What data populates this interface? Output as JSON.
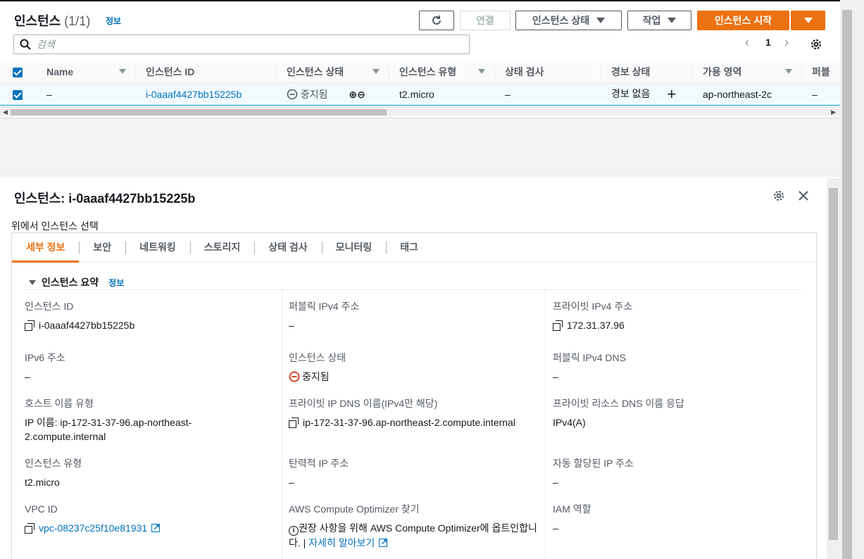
{
  "header": {
    "title": "인스턴스",
    "count": "(1/1)",
    "info": "정보",
    "buttons": {
      "connect": "연결",
      "instance_state": "인스턴스 상태",
      "actions": "작업",
      "launch": "인스턴스 시작"
    },
    "search_placeholder": "검색",
    "page": "1"
  },
  "table": {
    "columns": [
      "Name",
      "인스턴스 ID",
      "인스턴스 상태",
      "인스턴스 유형",
      "상태 검사",
      "경보 상태",
      "가용 영역",
      "퍼블"
    ],
    "row": {
      "name": "–",
      "instance_id": "i-0aaaf4427bb15225b",
      "state": "중지됨",
      "type": "t2.micro",
      "status_check": "–",
      "alarm": "경보 없음",
      "az": "ap-northeast-2c",
      "public": "–"
    }
  },
  "detail": {
    "title": "인스턴스: i-0aaaf4427bb15225b",
    "select_hint": "위에서 인스턴스 선택",
    "tabs": [
      "세부 정보",
      "보안",
      "네트워킹",
      "스토리지",
      "상태 검사",
      "모니터링",
      "태그"
    ],
    "summary_title": "인스턴스 요약",
    "summary_info": "정보",
    "fields": {
      "instance_id_label": "인스턴스 ID",
      "instance_id": "i-0aaaf4427bb15225b",
      "public_ipv4_label": "퍼블릭 IPv4 주소",
      "public_ipv4": "–",
      "private_ipv4_label": "프라이빗 IPv4 주소",
      "private_ipv4": "172.31.37.96",
      "ipv6_label": "IPv6 주소",
      "ipv6": "–",
      "state_label": "인스턴스 상태",
      "state": "중지됨",
      "public_dns_label": "퍼블릭 IPv4 DNS",
      "public_dns": "–",
      "hostname_type_label": "호스트 이름 유형",
      "hostname_type": "IP 이름: ip-172-31-37-96.ap-northeast-2.compute.internal",
      "private_dns_label": "프라이빗 IP DNS 이름(IPv4만 해당)",
      "private_dns": "ip-172-31-37-96.ap-northeast-2.compute.internal",
      "resource_dns_label": "프라이빗 리소스 DNS 이름 응답",
      "resource_dns": "IPv4(A)",
      "instance_type_label": "인스턴스 유형",
      "instance_type": "t2.micro",
      "elastic_ip_label": "탄력적 IP 주소",
      "elastic_ip": "–",
      "auto_ip_label": "자동 할당된 IP 주소",
      "auto_ip": "–",
      "vpc_label": "VPC ID",
      "vpc": "vpc-08237c25f10e81931",
      "optimizer_label": "AWS Compute Optimizer 찾기",
      "optimizer_text": "권장 사항을 위해 AWS Compute Optimizer에 옵트인합니다. |",
      "optimizer_link": "자세히 알아보기",
      "iam_label": "IAM 역할",
      "iam": "–"
    }
  },
  "colors": {
    "accent": "#ec7211",
    "link": "#0073bb",
    "stopped": "#d13212"
  }
}
